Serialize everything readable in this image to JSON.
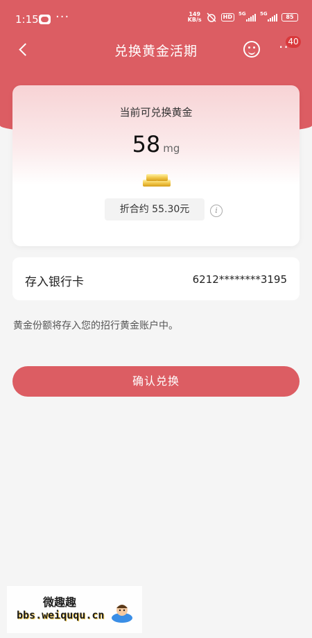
{
  "status_bar": {
    "time": "1:15",
    "net_speed_value": "149",
    "net_speed_unit": "KB/s",
    "hd_label": "HD",
    "signal_label_1": "5G",
    "signal_label_2": "5G",
    "battery": "85"
  },
  "nav": {
    "title": "兑换黄金活期",
    "badge_count": "40"
  },
  "gold_card": {
    "label": "当前可兑换黄金",
    "amount": "58",
    "unit": "mg",
    "equivalent": "折合约 55.30元",
    "info_glyph": "i"
  },
  "bank": {
    "label": "存入银行卡",
    "card_number": "6212********3195"
  },
  "note": "黄金份额将存入您的招行黄金账户中。",
  "confirm_label": "确认兑换",
  "watermark": {
    "title": "微趣趣",
    "url": "bbs.weiququ.cn"
  },
  "colors": {
    "primary": "#dc5d63",
    "badge": "#d9393c",
    "page_bg": "#f5f5f5"
  }
}
